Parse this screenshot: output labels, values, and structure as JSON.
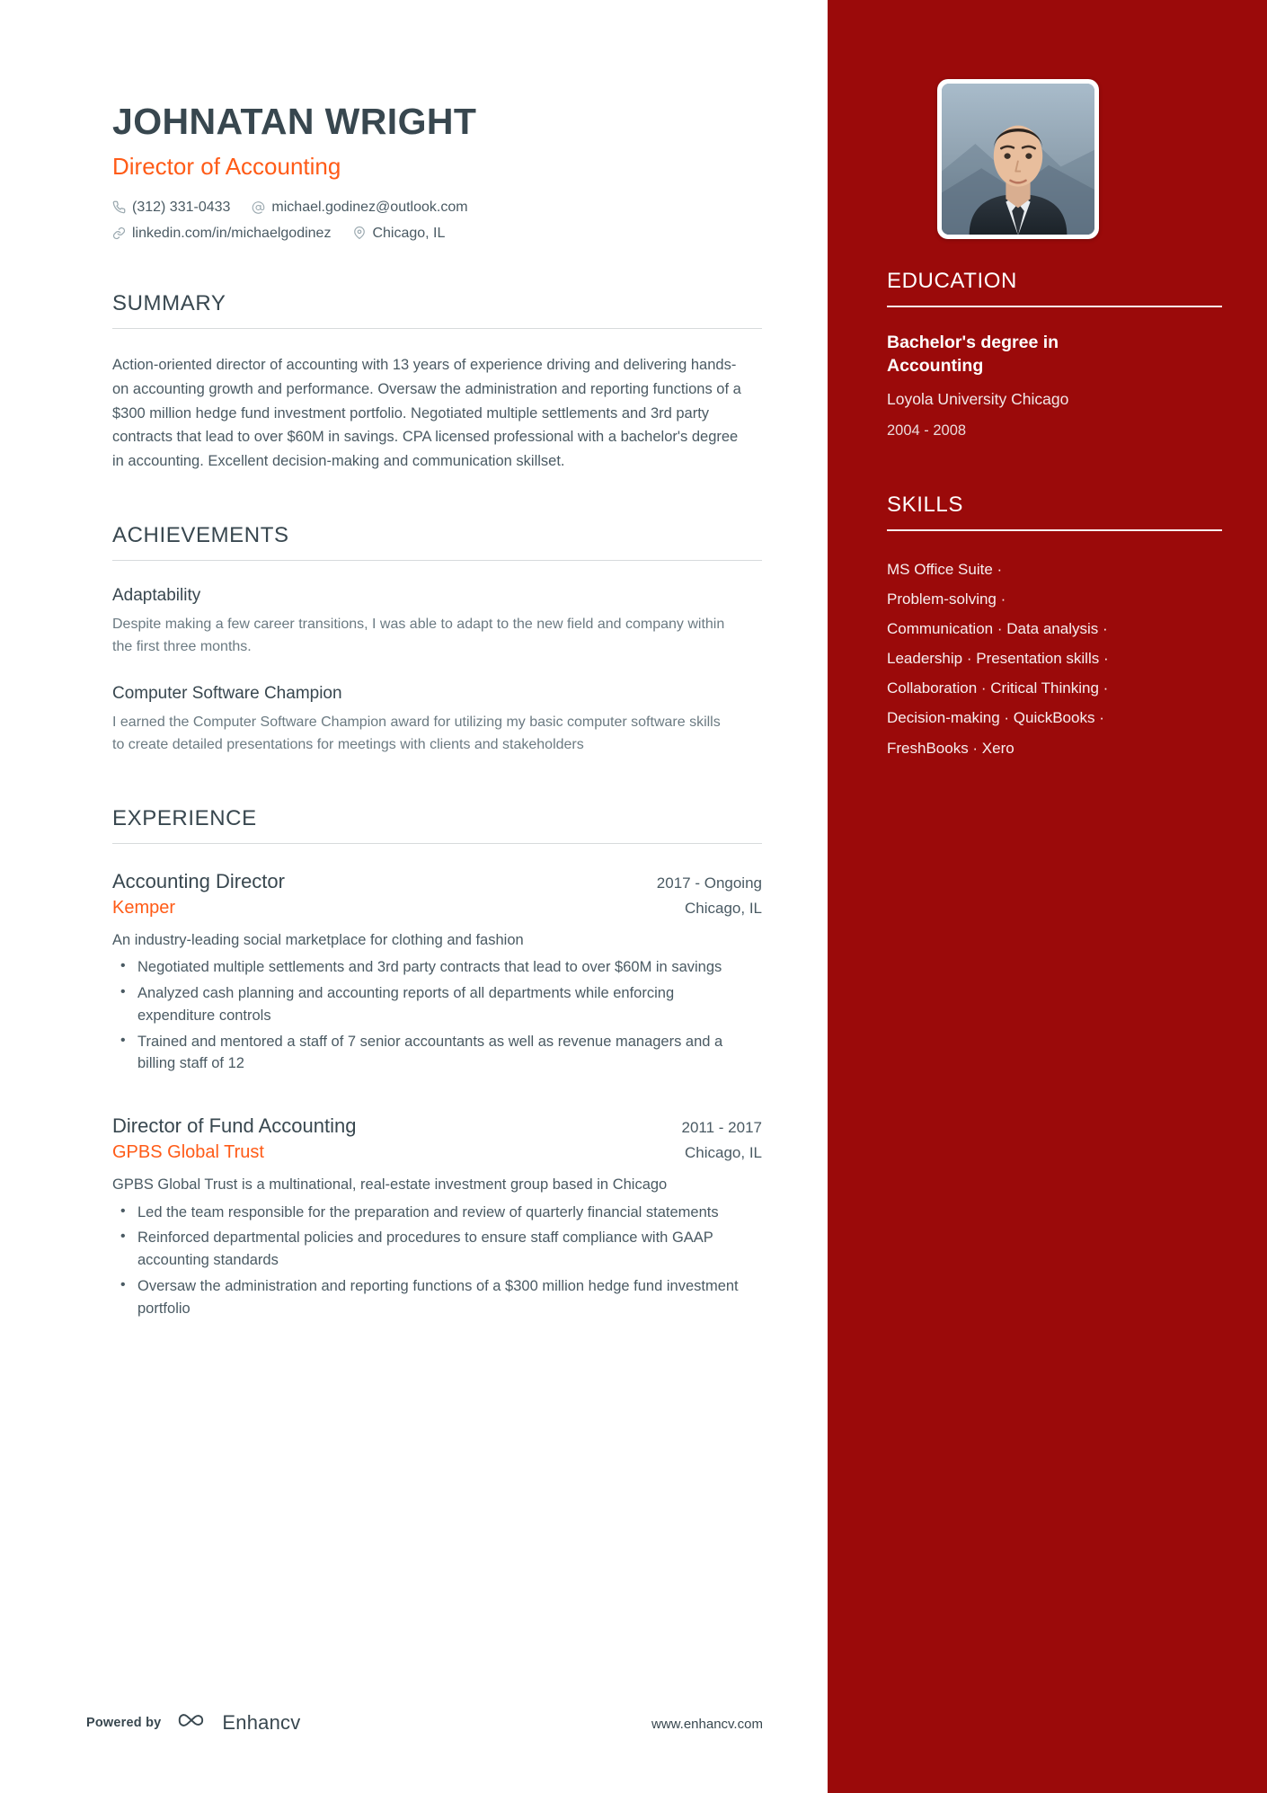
{
  "header": {
    "name": "JOHNATAN WRIGHT",
    "job_title": "Director of Accounting",
    "contacts": {
      "phone": "(312) 331-0433",
      "email": "michael.godinez@outlook.com",
      "linkedin": "linkedin.com/in/michaelgodinez",
      "location": "Chicago, IL"
    }
  },
  "summary": {
    "heading": "SUMMARY",
    "text": "Action-oriented director of accounting with 13 years of experience driving and delivering hands-on accounting growth and performance. Oversaw the administration and reporting functions of a $300 million hedge fund investment portfolio. Negotiated multiple settlements and 3rd party contracts that lead to over $60M in savings. CPA licensed professional with a bachelor's degree in accounting. Excellent decision-making and communication skillset."
  },
  "achievements": {
    "heading": "ACHIEVEMENTS",
    "items": [
      {
        "title": "Adaptability",
        "description": "Despite making a few career transitions, I was able to adapt to the new field and company within the first three months."
      },
      {
        "title": "Computer Software Champion",
        "description": "I earned the Computer Software Champion award for utilizing my basic computer software skills to create detailed presentations for meetings with clients and stakeholders"
      }
    ]
  },
  "experience": {
    "heading": "EXPERIENCE",
    "items": [
      {
        "role": "Accounting Director",
        "dates": "2017 - Ongoing",
        "company": "Kemper",
        "location": "Chicago, IL",
        "summary": "An industry-leading social marketplace for clothing and fashion",
        "bullets": [
          "Negotiated multiple settlements and 3rd party contracts that lead to over $60M in savings",
          "Analyzed cash planning and accounting reports of all departments while enforcing expenditure controls",
          "Trained and mentored a staff of 7 senior accountants as well as revenue managers and a billing staff of 12"
        ]
      },
      {
        "role": "Director of Fund Accounting",
        "dates": "2011 - 2017",
        "company": "GPBS Global Trust",
        "location": "Chicago, IL",
        "summary": "GPBS Global Trust is a multinational, real-estate investment group based in Chicago",
        "bullets": [
          "Led the team responsible for the preparation and review of quarterly financial statements",
          "Reinforced departmental policies and procedures to ensure staff compliance with GAAP accounting standards",
          "Oversaw the administration and reporting functions of a $300 million hedge fund investment portfolio"
        ]
      }
    ]
  },
  "education": {
    "heading": "EDUCATION",
    "degree": "Bachelor's degree in Accounting",
    "school": "Loyola University Chicago",
    "dates": "2004 - 2008"
  },
  "skills": {
    "heading": "SKILLS",
    "lines": [
      "MS Office Suite ·",
      "Problem-solving ·",
      "Communication · Data analysis ·",
      "Leadership · Presentation skills ·",
      "Collaboration · Critical Thinking ·",
      "Decision-making · QuickBooks ·",
      "FreshBooks · Xero"
    ]
  },
  "footer": {
    "powered_by": "Powered by",
    "brand": "Enhancv",
    "url": "www.enhancv.com"
  },
  "colors": {
    "accent_orange": "#FF5B17",
    "sidebar_red": "#9B0A0A",
    "heading_slate": "#38474F"
  }
}
